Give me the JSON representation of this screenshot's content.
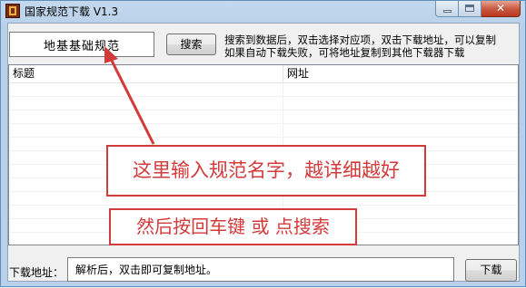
{
  "window": {
    "title": "国家规范下载 V1.3",
    "icon": "app-book-icon",
    "close_glyph": "✕"
  },
  "search": {
    "input_value": "地基基础规范",
    "button_label": "搜索",
    "hint_line1": "搜索到数据后，双击选择对应项，双击下载地址，可以复制",
    "hint_line2": "如果自动下载失败，可将地址复制到其他下载器下载"
  },
  "table": {
    "columns": [
      "标题",
      "网址"
    ],
    "rows": []
  },
  "annotations": {
    "callout_1": "这里输入规范名字，越详细越好",
    "callout_2": "然后按回车键 或 点搜索",
    "color": "#d33a3a"
  },
  "footer": {
    "download_label": "下载地址：",
    "download_value": "解析后，双击即可复制地址。",
    "download_button": "下载"
  }
}
